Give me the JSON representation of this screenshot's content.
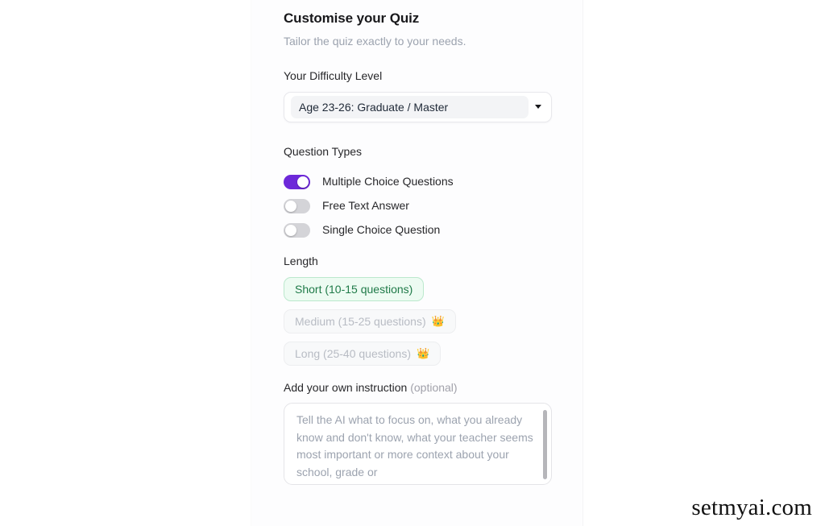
{
  "header": {
    "title": "Customise your Quiz",
    "subtitle": "Tailor the quiz exactly to your needs."
  },
  "difficulty": {
    "label": "Your Difficulty Level",
    "selected": "Age 23-26: Graduate / Master",
    "caret_icon": "chevron-down-icon"
  },
  "question_types": {
    "label": "Question Types",
    "items": [
      {
        "label": "Multiple Choice Questions",
        "on": true
      },
      {
        "label": "Free Text Answer",
        "on": false
      },
      {
        "label": "Single Choice Question",
        "on": false
      }
    ]
  },
  "length": {
    "label": "Length",
    "options": [
      {
        "label": "Short (10-15 questions)",
        "state": "selected",
        "badge": ""
      },
      {
        "label": "Medium (15-25 questions)",
        "state": "locked",
        "badge": "👑"
      },
      {
        "label": "Long (25-40 questions)",
        "state": "locked",
        "badge": "👑"
      }
    ]
  },
  "instruction": {
    "label": "Add your own instruction",
    "optional": "(optional)",
    "placeholder": "Tell the AI what to focus on, what you already know and don't know, what your teacher seems most important or more context about your school, grade or"
  },
  "watermark": "setmyai.com",
  "colors": {
    "accent_purple": "#6d28d9",
    "toggle_off": "#d4d4d8",
    "selected_green_bg": "#edfbf2",
    "selected_green_border": "#bbe8cd",
    "selected_green_text": "#1f7a48",
    "locked_text": "#b8bcc4",
    "crown_gold": "#f5a623"
  }
}
